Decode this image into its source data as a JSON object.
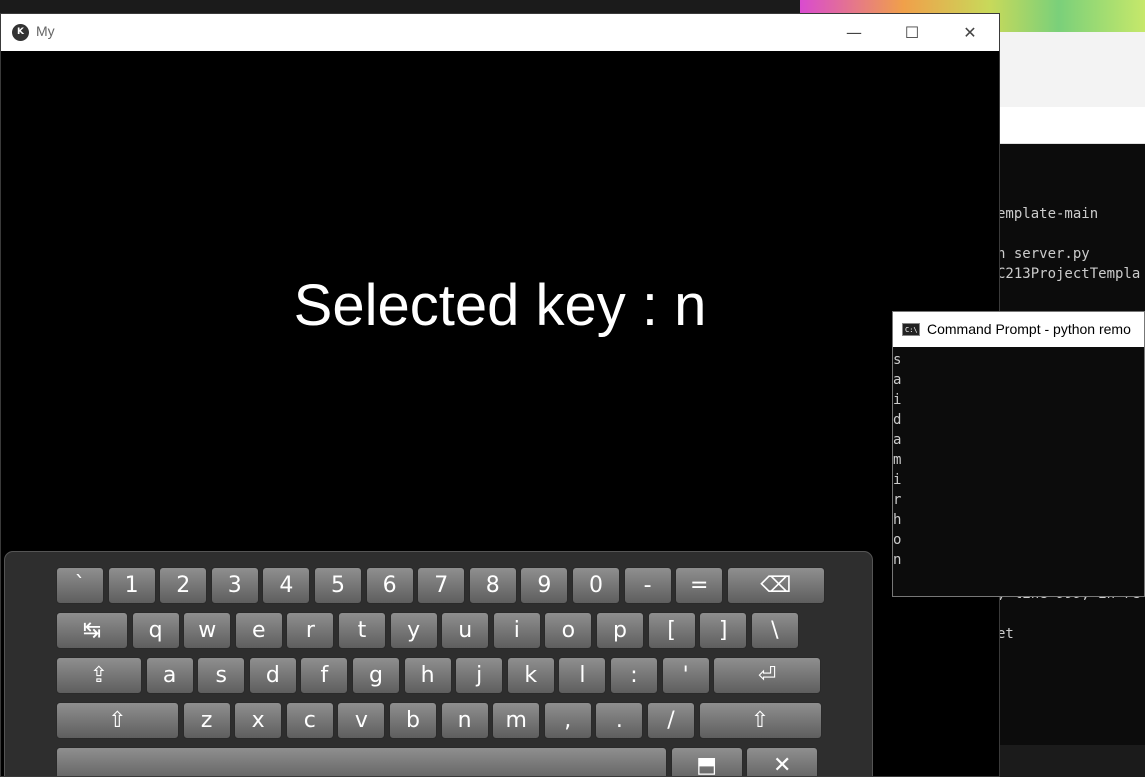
{
  "background_terminal": {
    "lines": [
      "emplate-main",
      "n server.py",
      "C213ProjectTempla",
      ", line 999, in re",
      "et"
    ]
  },
  "app_window": {
    "title": "My",
    "controls": {
      "minimize": "—",
      "maximize": "☐",
      "close": "✕"
    },
    "selected_key_text": "Selected key : n"
  },
  "keyboard": {
    "rows": [
      [
        "`",
        "1",
        "2",
        "3",
        "4",
        "5",
        "6",
        "7",
        "8",
        "9",
        "0",
        "-",
        "=",
        "⌫"
      ],
      [
        "↹",
        "q",
        "w",
        "e",
        "r",
        "t",
        "y",
        "u",
        "i",
        "o",
        "p",
        "[",
        "]",
        "\\"
      ],
      [
        "⇪",
        "a",
        "s",
        "d",
        "f",
        "g",
        "h",
        "j",
        "k",
        "l",
        ":",
        "'",
        "⏎"
      ],
      [
        "⇧",
        "z",
        "x",
        "c",
        "v",
        "b",
        "n",
        "m",
        ",",
        ".",
        "/",
        "⇧"
      ],
      [
        " ",
        "⬒",
        "✕"
      ]
    ]
  },
  "cmd_window": {
    "title": "Command Prompt - python  remo",
    "output": [
      "s",
      "a",
      "i",
      "d",
      "a",
      "m",
      "i",
      "r",
      "h",
      "o",
      "n"
    ]
  }
}
